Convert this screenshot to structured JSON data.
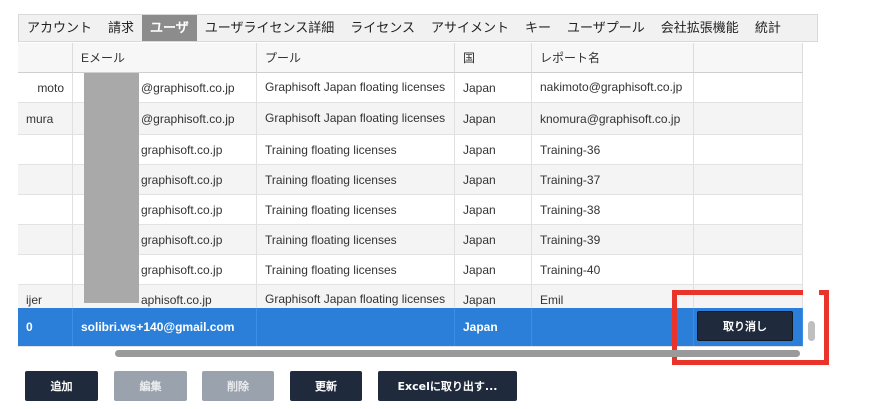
{
  "tabs": [
    {
      "label": "アカウント"
    },
    {
      "label": "請求"
    },
    {
      "label": "ユーザ"
    },
    {
      "label": "ユーザライセンス詳細"
    },
    {
      "label": "ライセンス"
    },
    {
      "label": "アサイメント"
    },
    {
      "label": "キー"
    },
    {
      "label": "ユーザプール"
    },
    {
      "label": "会社拡張機能"
    },
    {
      "label": "統計"
    }
  ],
  "table": {
    "columns": [
      "",
      "Eメール",
      "プール",
      "国",
      "レポート名",
      ""
    ],
    "rows": [
      {
        "name": "moto",
        "email": "@graphisoft.co.jp",
        "pool": "Graphisoft Japan floating licenses",
        "country": "Japan",
        "report": "nakimoto@graphisoft.co.jp"
      },
      {
        "name": "mura",
        "email": "@graphisoft.co.jp",
        "pool": "Graphisoft Japan floating licenses",
        "country": "Japan",
        "report": "knomura@graphisoft.co.jp"
      },
      {
        "name": "",
        "email": "graphisoft.co.jp",
        "pool": "Training floating licenses",
        "country": "Japan",
        "report": "Training-36"
      },
      {
        "name": "",
        "email": "graphisoft.co.jp",
        "pool": "Training floating licenses",
        "country": "Japan",
        "report": "Training-37"
      },
      {
        "name": "",
        "email": "graphisoft.co.jp",
        "pool": "Training floating licenses",
        "country": "Japan",
        "report": "Training-38"
      },
      {
        "name": "",
        "email": "graphisoft.co.jp",
        "pool": "Training floating licenses",
        "country": "Japan",
        "report": "Training-39"
      },
      {
        "name": "",
        "email": "graphisoft.co.jp",
        "pool": "Training floating licenses",
        "country": "Japan",
        "report": "Training-40"
      },
      {
        "name": "ijer",
        "email": "aphisoft.co.jp",
        "pool": "Graphisoft Japan floating licenses",
        "country": "Japan",
        "report": "Emil"
      }
    ],
    "selected_row": {
      "name": "0",
      "email": "solibri.ws+140@gmail.com",
      "pool": "",
      "country": "Japan",
      "report": "",
      "action": "取り消し"
    }
  },
  "footer": {
    "add": "追加",
    "edit": "編集",
    "delete": "削除",
    "update": "更新",
    "export": "Excelに取り出す..."
  },
  "colors": {
    "accent": "#2b7fd8",
    "highlight": "#e8342a",
    "button": "#1f2a3c"
  }
}
